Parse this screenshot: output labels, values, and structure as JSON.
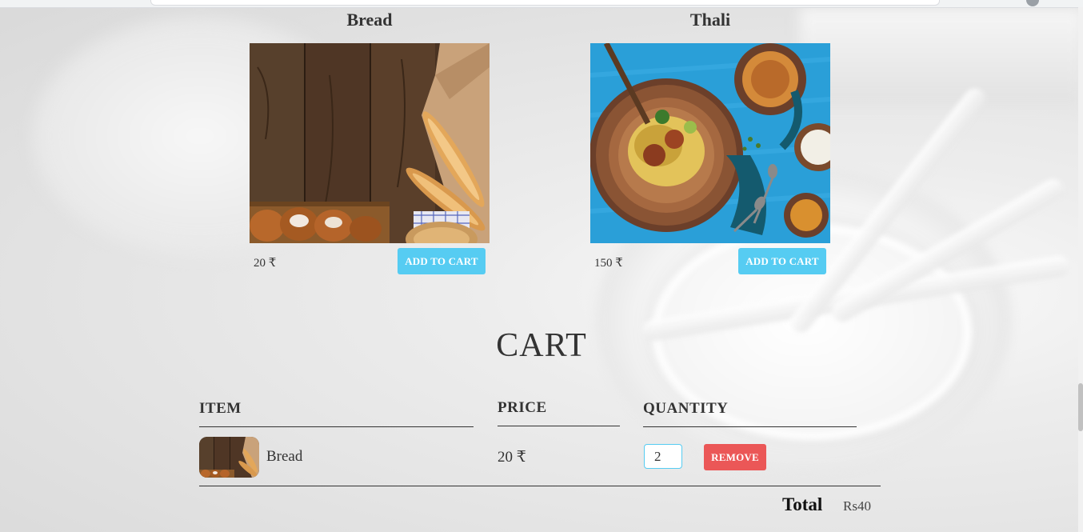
{
  "products": [
    {
      "title": "Bread",
      "price": "20 ₹",
      "button_label": "ADD TO CART",
      "image": "bread-photo"
    },
    {
      "title": "Thali",
      "price": "150 ₹",
      "button_label": "ADD TO CART",
      "image": "thali-photo"
    }
  ],
  "cart": {
    "title": "CART",
    "headers": {
      "item": "ITEM",
      "price": "PRICE",
      "quantity": "QUANTITY"
    },
    "rows": [
      {
        "name": "Bread",
        "price": "20 ₹",
        "quantity": "2",
        "remove_label": "REMOVE",
        "image": "bread-thumbnail"
      }
    ],
    "total_label": "Total",
    "total_value": "Rs40"
  },
  "colors": {
    "add_button": "#56ccf2",
    "remove_button": "#eb5757",
    "text": "#333333"
  }
}
